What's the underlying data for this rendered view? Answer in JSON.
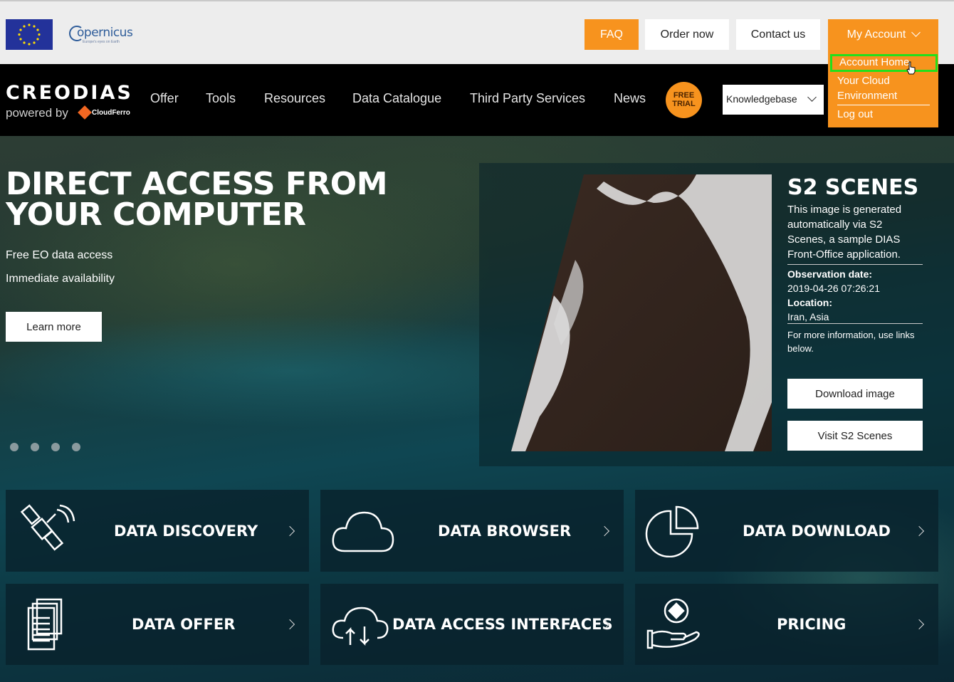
{
  "top": {
    "faq": "FAQ",
    "order_now": "Order now",
    "contact_us": "Contact us",
    "my_account": "My Account"
  },
  "account_menu": {
    "home": "Account Home",
    "cloud": "Your Cloud Environment",
    "logout": "Log out"
  },
  "logo": {
    "brand": "CREODIAS",
    "powered": "powered by",
    "partner": "CloudFerro"
  },
  "copernicus": {
    "name": "opernicus",
    "tagline": "Europe's eyes on Earth"
  },
  "nav": {
    "items": [
      {
        "label": "Offer"
      },
      {
        "label": "Tools"
      },
      {
        "label": "Resources"
      },
      {
        "label": "Data Catalogue"
      },
      {
        "label": "Third Party Services"
      },
      {
        "label": "News"
      }
    ],
    "free_trial_1": "FREE",
    "free_trial_2": "TRIAL",
    "knowledgebase": "Knowledgebase"
  },
  "hero": {
    "title": "DIRECT ACCESS FROM YOUR COMPUTER",
    "bullet1": "Free EO data access",
    "bullet2": "Immediate availability",
    "learn_more": "Learn more",
    "slides": 4
  },
  "s2": {
    "title": "S2 SCENES",
    "description": "This image is generated automatically via S2 Scenes, a sample DIAS Front-Office application.",
    "obs_label": "Observation date:",
    "obs_value": "2019-04-26 07:26:21",
    "loc_label": "Location:",
    "loc_value": "Iran, Asia",
    "more_info": "For more information, use links below.",
    "download": "Download image",
    "visit": "Visit S2 Scenes"
  },
  "tiles": [
    {
      "label": "DATA DISCOVERY",
      "icon": "satellite-icon"
    },
    {
      "label": "DATA BROWSER",
      "icon": "cloud-icon"
    },
    {
      "label": "DATA DOWNLOAD",
      "icon": "pie-chart-icon"
    },
    {
      "label": "DATA OFFER",
      "icon": "documents-icon"
    },
    {
      "label": "DATA ACCESS INTERFACES",
      "icon": "cloud-transfer-icon"
    },
    {
      "label": "PRICING",
      "icon": "hand-coin-icon"
    }
  ],
  "colors": {
    "accent": "#f7931e",
    "highlight": "#22e01c",
    "nav_bg": "#000000"
  }
}
